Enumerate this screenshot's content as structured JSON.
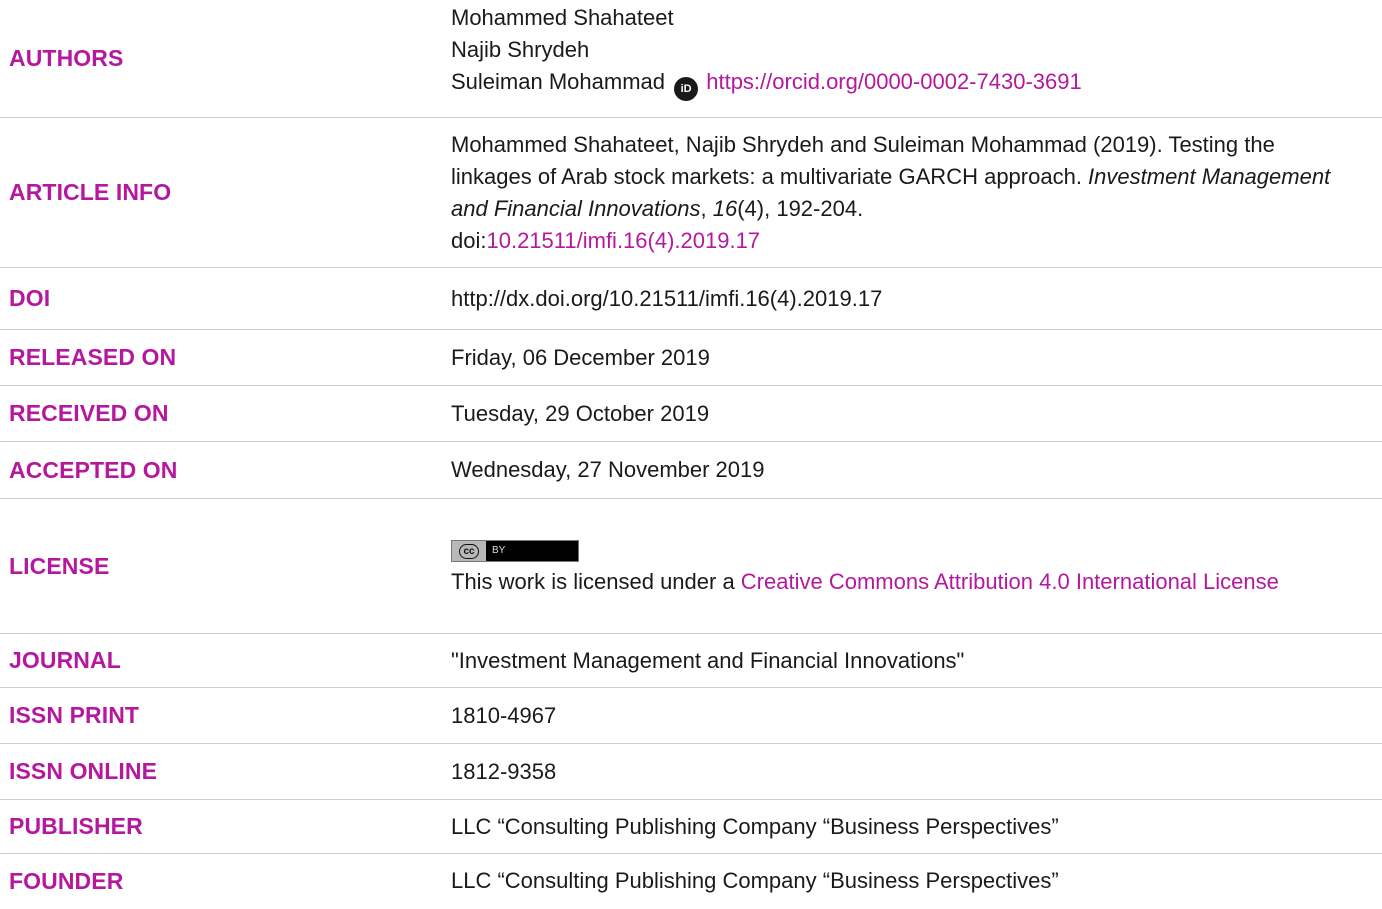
{
  "colors": {
    "label": "#b5189e",
    "link": "#b5189e",
    "text": "#1a1a1a",
    "divider": "#cfcfcf"
  },
  "rows": {
    "authors": {
      "label": "AUTHORS",
      "names": [
        "Mohammed Shahateet",
        "Najib Shrydeh",
        "Suleiman Mohammad"
      ],
      "orcid_icon": "orcid-icon",
      "orcid_url": "https://orcid.org/0000-0002-7430-3691"
    },
    "article_info": {
      "label": "ARTICLE INFO",
      "citation_prefix": "Mohammed Shahateet, Najib Shrydeh and Suleiman Mohammad (2019). Testing the linkages of Arab stock markets: a multivariate GARCH approach. ",
      "journal": "Investment Management and Financial Innovations",
      "comma": ", ",
      "volume": "16",
      "issue_pages": "(4), 192-204.",
      "doi_prefix": "doi:",
      "doi_link": "10.21511/imfi.16(4).2019.17"
    },
    "doi": {
      "label": "DOI",
      "value": "http://dx.doi.org/10.21511/imfi.16(4).2019.17"
    },
    "released": {
      "label": "RELEASED ON",
      "value": "Friday, 06 December 2019"
    },
    "received": {
      "label": "RECEIVED ON",
      "value": "Tuesday, 29 October 2019"
    },
    "accepted": {
      "label": "ACCEPTED ON",
      "value": "Wednesday, 27 November 2019"
    },
    "license": {
      "label": "LICENSE",
      "badge_cc": "cc",
      "badge_by": "BY",
      "text_prefix": "This work is licensed under a ",
      "link": "Creative Commons Attribution 4.0 International License"
    },
    "journal": {
      "label": "JOURNAL",
      "value": "\"Investment Management and Financial Innovations\""
    },
    "issn_print": {
      "label": "ISSN PRINT",
      "value": "1810-4967"
    },
    "issn_online": {
      "label": "ISSN ONLINE",
      "value": "1812-9358"
    },
    "publisher": {
      "label": "PUBLISHER",
      "value": "LLC “Consulting Publishing Company “Business Perspectives”"
    },
    "founder": {
      "label": "FOUNDER",
      "value": "LLC “Consulting Publishing Company “Business Perspectives”"
    }
  }
}
